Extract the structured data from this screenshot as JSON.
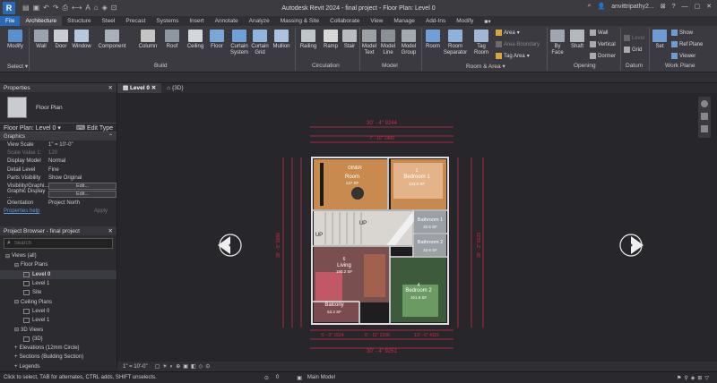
{
  "app": {
    "title": "Autodesk Revit 2024 - final project - Floor Plan: Level 0",
    "logo": "R",
    "user": "anvittripathy2...",
    "accent": "#2a6ab5"
  },
  "tabs": [
    "File",
    "Architecture",
    "Structure",
    "Steel",
    "Precast",
    "Systems",
    "Insert",
    "Annotate",
    "Analyze",
    "Massing & Site",
    "Collaborate",
    "View",
    "Manage",
    "Add-Ins",
    "Modify"
  ],
  "ribbon": {
    "modify": "Modify",
    "select": "Select",
    "build": {
      "label": "Build",
      "wall": "Wall",
      "door": "Door",
      "window": "Window",
      "component": "Component",
      "column": "Column",
      "roof": "Roof",
      "ceiling": "Ceiling",
      "floor": "Floor",
      "curtain_system": "Curtain System",
      "curtain_grid": "Curtain Grid",
      "mullion": "Mullion"
    },
    "circulation": {
      "label": "Circulation",
      "railing": "Railing",
      "ramp": "Ramp",
      "stair": "Stair"
    },
    "model": {
      "label": "Model",
      "text": "Model Text",
      "line": "Model Line",
      "group": "Model Group"
    },
    "room": {
      "label": "Room & Area",
      "room": "Room",
      "separator": "Room Separator",
      "tag": "Tag Room",
      "area": "Area",
      "area_boundary": "Area Boundary",
      "tag_area": "Tag Area"
    },
    "opening": {
      "label": "Opening",
      "byface": "By Face",
      "shaft": "Shaft",
      "wall": "Wall",
      "vertical": "Vertical",
      "dormer": "Dormer"
    },
    "datum": {
      "label": "Datum",
      "level": "Level",
      "grid": "Grid"
    },
    "workplane": {
      "label": "Work Plane",
      "set": "Set",
      "show": "Show",
      "refplane": "Ref Plane",
      "viewer": "Viewer"
    }
  },
  "properties": {
    "title": "Properties",
    "type": "Floor Plan",
    "selector": "Floor Plan: Level 0",
    "edit_type": "Edit Type",
    "section": "Graphics",
    "rows": [
      {
        "k": "View Scale",
        "v": "1\" = 10'-0\""
      },
      {
        "k": "Scale Value 1:",
        "v": "120"
      },
      {
        "k": "Display Model",
        "v": "Normal"
      },
      {
        "k": "Detail Level",
        "v": "Fine"
      },
      {
        "k": "Parts Visibility",
        "v": "Show Original"
      },
      {
        "k": "Visibility/Graphi...",
        "v": "Edit..."
      },
      {
        "k": "Graphic Display ...",
        "v": "Edit..."
      },
      {
        "k": "Orientation",
        "v": "Project North"
      }
    ],
    "help": "Properties help",
    "apply": "Apply"
  },
  "browser": {
    "title": "Project Browser - final project",
    "search_placeholder": "Search",
    "items": [
      {
        "label": "Views (all)",
        "indent": 0,
        "icon": "tree"
      },
      {
        "label": "Floor Plans",
        "indent": 1,
        "icon": "tree"
      },
      {
        "label": "Level 0",
        "indent": 2,
        "icon": "view",
        "bold": true
      },
      {
        "label": "Level 1",
        "indent": 2,
        "icon": "view"
      },
      {
        "label": "Site",
        "indent": 2,
        "icon": "view"
      },
      {
        "label": "Ceiling Plans",
        "indent": 1,
        "icon": "tree"
      },
      {
        "label": "Level 0",
        "indent": 2,
        "icon": "view"
      },
      {
        "label": "Level 1",
        "indent": 2,
        "icon": "view"
      },
      {
        "label": "3D Views",
        "indent": 1,
        "icon": "tree"
      },
      {
        "label": "{3D}",
        "indent": 2,
        "icon": "view"
      },
      {
        "label": "Elevations (12mm Circle)",
        "indent": 1,
        "icon": "plus"
      },
      {
        "label": "Sections (Building Section)",
        "indent": 1,
        "icon": "plus"
      },
      {
        "label": "Legends",
        "indent": 1,
        "icon": "plus"
      }
    ]
  },
  "view_tabs": [
    "Level 0",
    "{3D}"
  ],
  "plan": {
    "dim_top": "30' - 4\" 9244",
    "dim_top2": "7' - 10\" 2400",
    "dim_bottom1": "5' - 0\" 1524",
    "dim_bottom2": "6' - 11\" 2106",
    "dim_bottom3": "13' - 6\" 4115",
    "dim_bottom_total": "30' - 4\" 9251",
    "dim_left": "30' - 5\" 9266",
    "dim_right": "30' - 3\" 9223",
    "rooms": [
      {
        "name": "Room",
        "num": "3",
        "area": "147 SF"
      },
      {
        "name": "DINER",
        "num": "",
        "area": ""
      },
      {
        "name": "Bedroom 1",
        "num": "1",
        "area": "124.0 SF"
      },
      {
        "name": "Bathroom 1",
        "num": "3",
        "area": "32.6 SF"
      },
      {
        "name": "Bathroom 2",
        "num": "4",
        "area": "32.6 SF"
      },
      {
        "name": "Living",
        "num": "6",
        "area": "190.2 SF"
      },
      {
        "name": "Bedroom 2",
        "num": "4",
        "area": "161.9 SF"
      },
      {
        "name": "Balcony",
        "num": "",
        "area": "53.2 SF"
      }
    ],
    "up1": "UP",
    "up2": "UP"
  },
  "viewbar": {
    "scale": "1\" = 10'-0\""
  },
  "status": {
    "hint": "Click to select, TAB for alternates, CTRL adds, SHIFT unselects.",
    "model": "Main Model",
    "zero": "0"
  }
}
